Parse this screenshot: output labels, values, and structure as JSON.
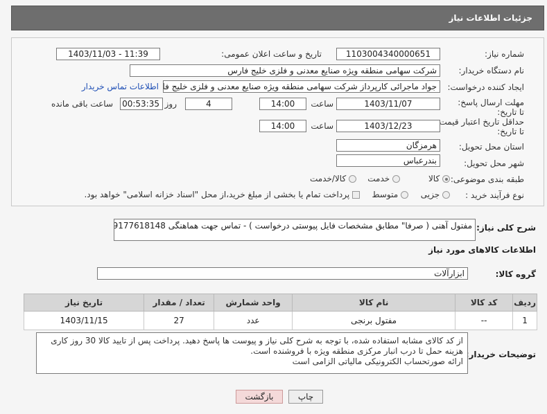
{
  "header": {
    "title": "جزئیات اطلاعات نیاز"
  },
  "form": {
    "need_number_label": "شماره نیاز:",
    "need_number": "1103004340000651",
    "announce_label": "تاریخ و ساعت اعلان عمومی:",
    "announce_value": "1403/11/03 - 11:39",
    "buyer_org_label": "نام دستگاه خریدار:",
    "buyer_org": "شرکت سهامی منطقه ویژه صنایع معدنی و فلزی خلیج فارس",
    "requester_label": "ایجاد کننده درخواست:",
    "requester": "جواد ماجرائی کارپرداز شرکت سهامی منطقه ویژه صنایع معدنی و فلزی خلیج فار",
    "contact_link": "اطلاعات تماس خریدار",
    "deadline_label": "مهلت ارسال پاسخ: تا تاریخ:",
    "deadline_date": "1403/11/07",
    "time_label": "ساعت",
    "deadline_time": "14:00",
    "days_value": "4",
    "days_label": "روز و",
    "remaining_time": "00:53:35",
    "remaining_label": "ساعت باقی مانده",
    "validity_label": "حداقل تاریخ اعتبار قیمت: تا تاریخ:",
    "validity_date": "1403/12/23",
    "validity_time": "14:00",
    "province_label": "استان محل تحویل:",
    "province": "هرمزگان",
    "city_label": "شهر محل تحویل:",
    "city": "بندرعباس",
    "category_label": "طبقه بندی موضوعی:",
    "category_options": [
      "کالا",
      "خدمت",
      "کالا/خدمت"
    ],
    "process_label": "نوع فرآیند خرید :",
    "process_options": [
      "جزیی",
      "متوسط"
    ],
    "payment_note": "پرداخت تمام یا بخشی از مبلغ خرید،از محل \"اسناد خزانه اسلامی\" خواهد بود."
  },
  "summary": {
    "label": "شرح کلی نیاز:",
    "value": "مفتول آهنی ( صرفا\" مطابق مشخصات فایل پیوستی درخواست ) - تماس جهت هماهنگی 09177618148"
  },
  "goods": {
    "section_title": "اطلاعات کالاهای مورد نیاز",
    "group_label": "گروه کالا:",
    "group_value": "ابزارآلات",
    "columns": [
      "ردیف",
      "کد کالا",
      "نام کالا",
      "واحد شمارش",
      "تعداد / مقدار",
      "تاریخ نیاز"
    ],
    "rows": [
      [
        "1",
        "--",
        "مفتول برنجی",
        "عدد",
        "27",
        "1403/11/15"
      ]
    ]
  },
  "notes": {
    "label": "توضیحات خریدار:",
    "line1": "از کد کالای مشابه استفاده شده، با توجه به شرح کلی نیاز و پیوست ها پاسخ دهید. پرداخت پس از تایید کالا  30 روز کاری",
    "line2": "هزینه حمل تا درب انبار مرکزی منطقه ویژه با فروشنده است.",
    "line3": "ارائه صورتحساب الکترونیکی مالیاتی الزامی است"
  },
  "buttons": {
    "print": "چاپ",
    "back": "بازگشت"
  }
}
